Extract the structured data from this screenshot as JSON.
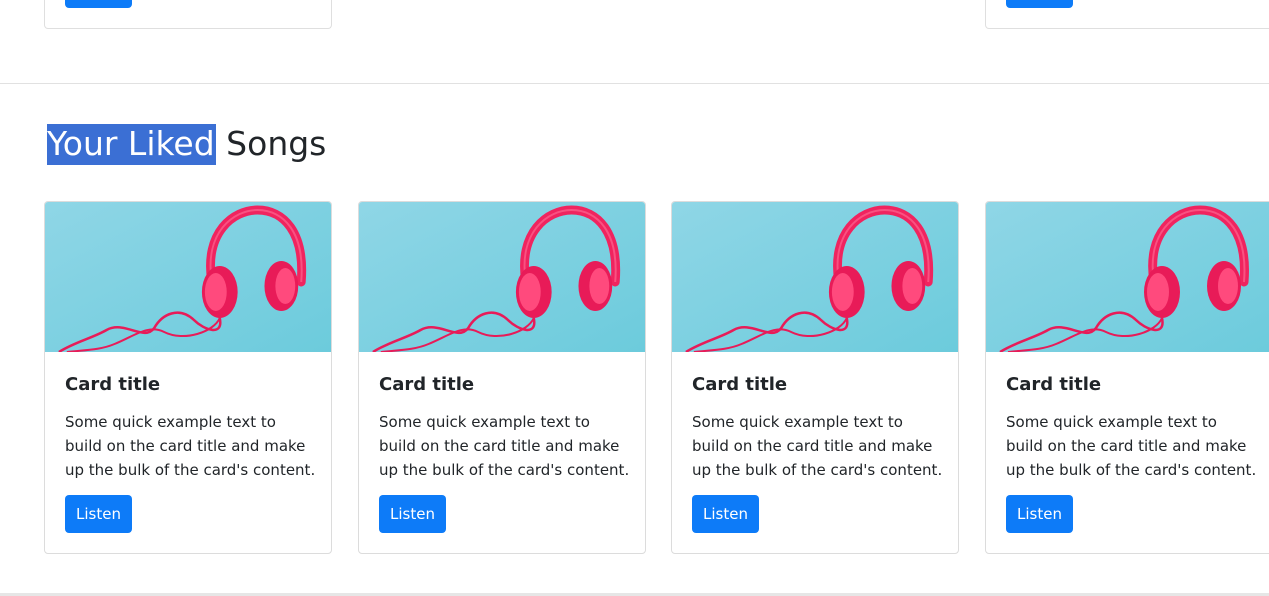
{
  "section": {
    "title_highlighted": "Your Liked",
    "title_rest": " Songs"
  },
  "cards": [
    {
      "title": "Card title",
      "text": "Some quick example text to build on the card title and make up the bulk of the card's content.",
      "button": "Listen"
    },
    {
      "title": "Card title",
      "text": "Some quick example text to build on the card title and make up the bulk of the card's content.",
      "button": "Listen"
    },
    {
      "title": "Card title",
      "text": "Some quick example text to build on the card title and make up the bulk of the card's content.",
      "button": "Listen"
    },
    {
      "title": "Card title",
      "text": "Some quick example text to build on the card title and make up the bulk of the card's content.",
      "button": "Listen"
    }
  ],
  "colors": {
    "primary": "#0d7bf8",
    "highlight": "#3b6fd4",
    "image_bg": "#7fd0e0",
    "headphones": "#f0245f"
  },
  "icons": {
    "card_image": "pink-headphones-image"
  }
}
